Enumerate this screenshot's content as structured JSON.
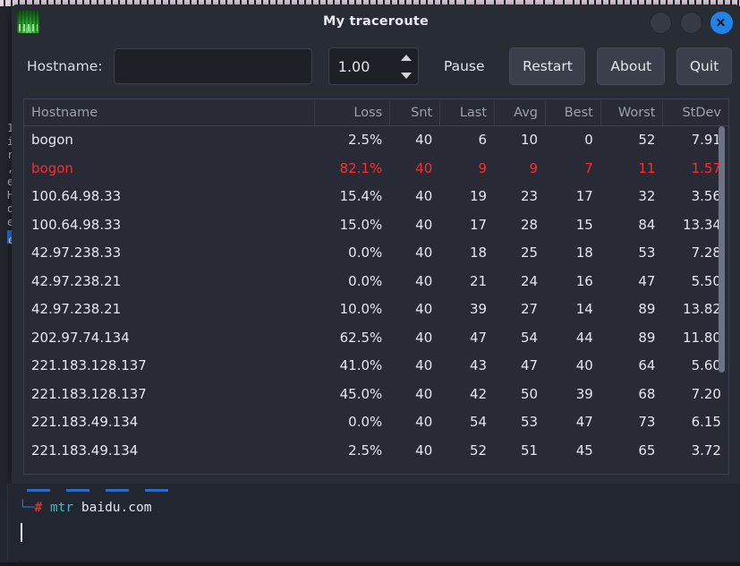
{
  "window": {
    "title": "My traceroute",
    "icon": "mtr-app-icon",
    "controls": {
      "minimize": "minimize",
      "maximize": "maximize",
      "close": "close"
    }
  },
  "toolbar": {
    "hostname_label": "Hostname:",
    "hostname_value": "",
    "hostname_placeholder": "",
    "interval_value": "1.00",
    "spin_up": "increase-interval",
    "spin_down": "decrease-interval",
    "pause_label": "Pause",
    "restart_label": "Restart",
    "about_label": "About",
    "quit_label": "Quit"
  },
  "table": {
    "columns": [
      "Hostname",
      "Loss",
      "Snt",
      "Last",
      "Avg",
      "Best",
      "Worst",
      "StDev"
    ],
    "rows": [
      {
        "host": "bogon",
        "loss": "2.5%",
        "snt": "40",
        "last": "6",
        "avg": "10",
        "best": "0",
        "worst": "52",
        "stdev": "7.91",
        "alert": false
      },
      {
        "host": "bogon",
        "loss": "82.1%",
        "snt": "40",
        "last": "9",
        "avg": "9",
        "best": "7",
        "worst": "11",
        "stdev": "1.57",
        "alert": true
      },
      {
        "host": "100.64.98.33",
        "loss": "15.4%",
        "snt": "40",
        "last": "19",
        "avg": "23",
        "best": "17",
        "worst": "32",
        "stdev": "3.56",
        "alert": false
      },
      {
        "host": "100.64.98.33",
        "loss": "15.0%",
        "snt": "40",
        "last": "17",
        "avg": "28",
        "best": "15",
        "worst": "84",
        "stdev": "13.34",
        "alert": false
      },
      {
        "host": "42.97.238.33",
        "loss": "0.0%",
        "snt": "40",
        "last": "18",
        "avg": "25",
        "best": "18",
        "worst": "53",
        "stdev": "7.28",
        "alert": false
      },
      {
        "host": "42.97.238.21",
        "loss": "0.0%",
        "snt": "40",
        "last": "21",
        "avg": "24",
        "best": "16",
        "worst": "47",
        "stdev": "5.50",
        "alert": false
      },
      {
        "host": "42.97.238.21",
        "loss": "10.0%",
        "snt": "40",
        "last": "39",
        "avg": "27",
        "best": "14",
        "worst": "89",
        "stdev": "13.82",
        "alert": false
      },
      {
        "host": "202.97.74.134",
        "loss": "62.5%",
        "snt": "40",
        "last": "47",
        "avg": "54",
        "best": "44",
        "worst": "89",
        "stdev": "11.80",
        "alert": false
      },
      {
        "host": "221.183.128.137",
        "loss": "41.0%",
        "snt": "40",
        "last": "43",
        "avg": "47",
        "best": "40",
        "worst": "64",
        "stdev": "5.60",
        "alert": false
      },
      {
        "host": "221.183.128.137",
        "loss": "45.0%",
        "snt": "40",
        "last": "42",
        "avg": "50",
        "best": "39",
        "worst": "68",
        "stdev": "7.20",
        "alert": false
      },
      {
        "host": "221.183.49.134",
        "loss": "0.0%",
        "snt": "40",
        "last": "54",
        "avg": "53",
        "best": "47",
        "worst": "73",
        "stdev": "6.15",
        "alert": false
      },
      {
        "host": "221.183.49.134",
        "loss": "2.5%",
        "snt": "40",
        "last": "52",
        "avg": "51",
        "best": "45",
        "worst": "65",
        "stdev": "3.72",
        "alert": false
      },
      {
        "host": "",
        "loss": "",
        "snt": "",
        "last": "",
        "avg": "",
        "best": "",
        "worst": "",
        "stdev": "",
        "alert": false
      }
    ]
  },
  "terminal": {
    "prompt_corner": "└─",
    "prompt_symbol": "#",
    "command": "mtr",
    "argument": "baidu.com"
  },
  "colors": {
    "window_bg": "#282c35",
    "table_bg": "#282b36",
    "terminal_bg": "#22262f",
    "accent_close": "#2183e8",
    "alert_row": "#ff2b2b",
    "prompt_blue": "#2b6fd0",
    "prompt_red": "#e03131",
    "command_cyan": "#3fb9c9",
    "header_text": "#9aa0ad"
  }
}
